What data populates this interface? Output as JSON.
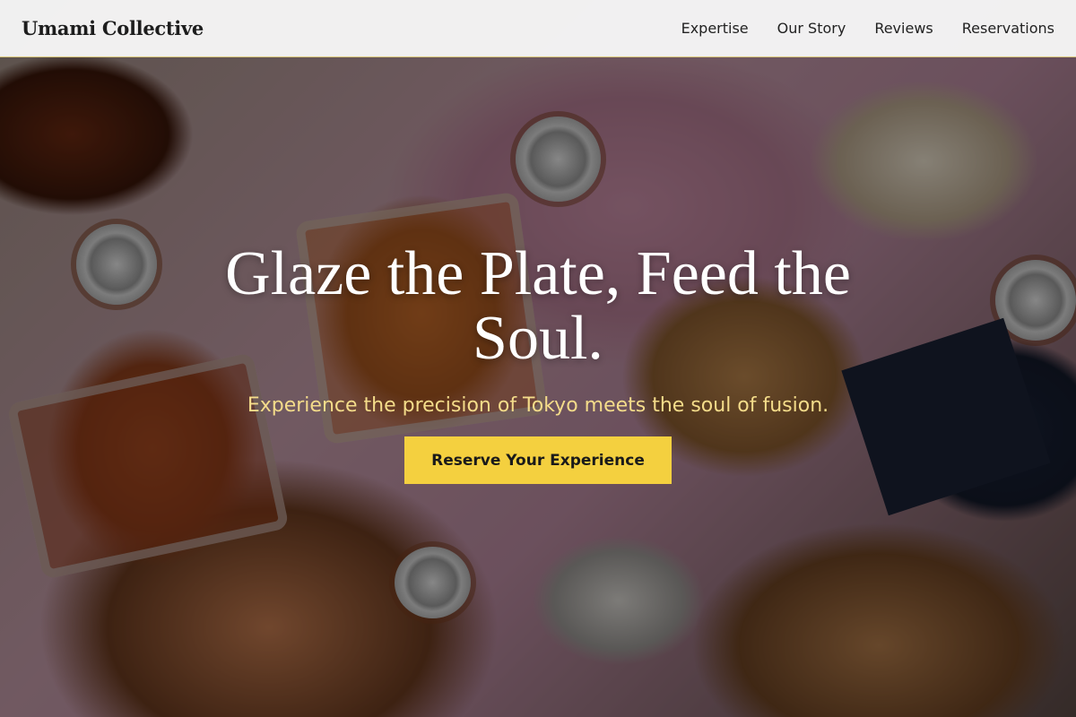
{
  "header": {
    "brand": "Umami Collective",
    "nav": [
      {
        "label": "Expertise"
      },
      {
        "label": "Our Story"
      },
      {
        "label": "Reviews"
      },
      {
        "label": "Reservations"
      }
    ]
  },
  "hero": {
    "title": "Glaze the Plate, Feed the Soul.",
    "subtitle": "Experience the precision of Tokyo meets the soul of fusion.",
    "cta_label": "Reserve Your Experience",
    "background_image": "overhead-food-table-photo"
  },
  "colors": {
    "accent": "#f4d03f",
    "subtitle": "#f4dc8a",
    "header_bg": "#f7f7f7"
  }
}
